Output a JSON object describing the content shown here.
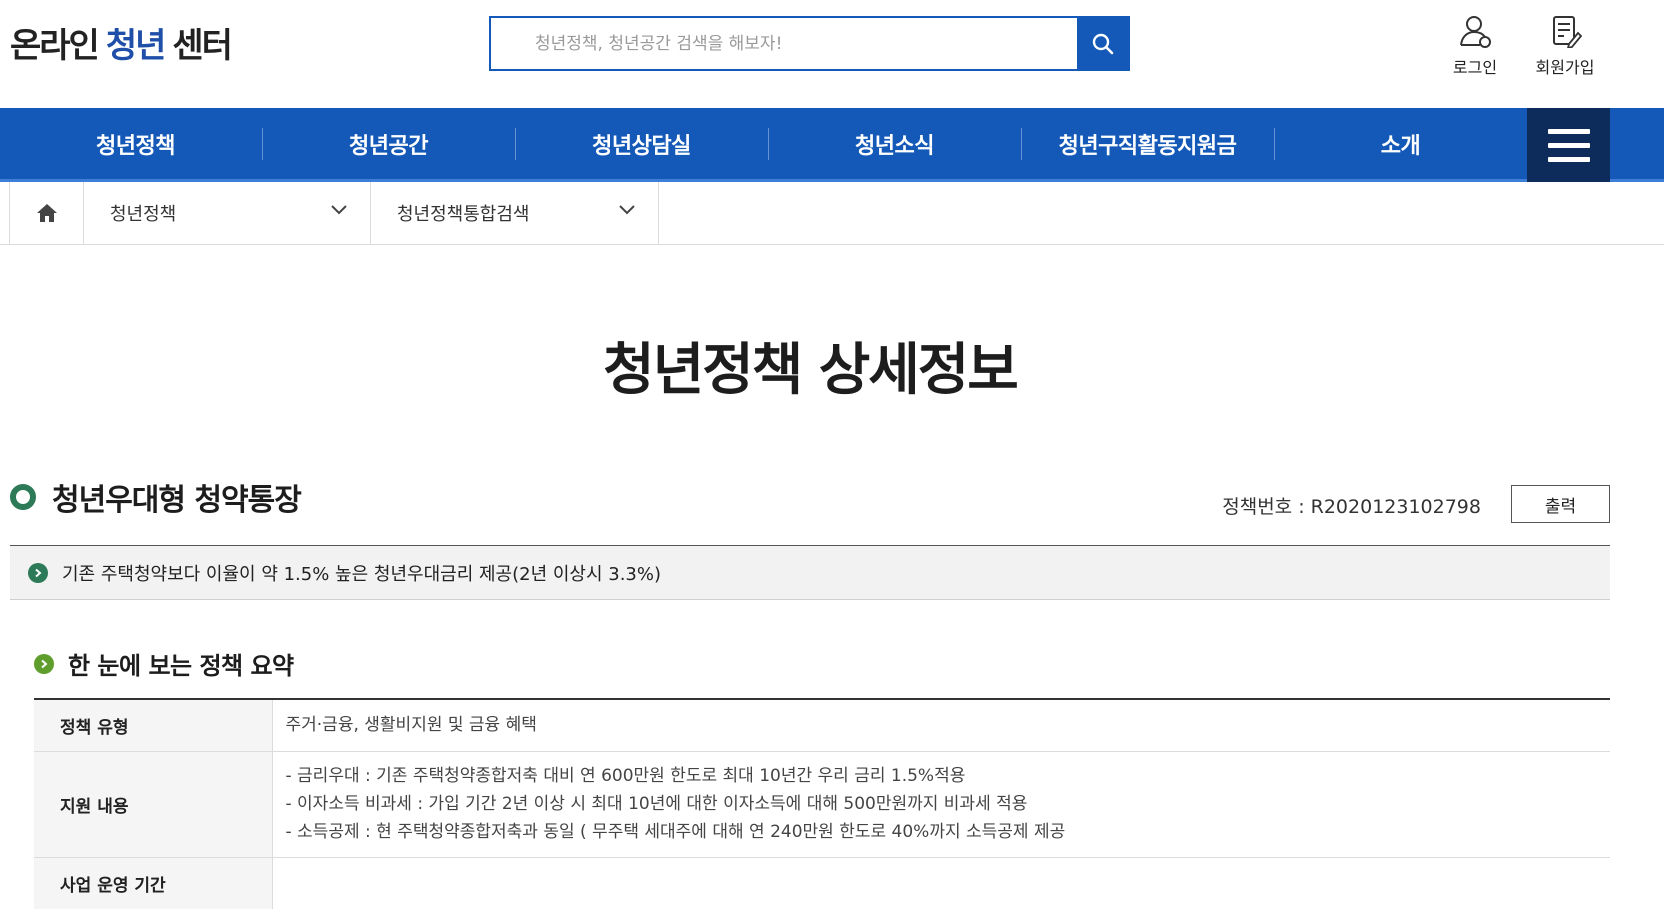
{
  "header": {
    "logo": {
      "part1": "온라인",
      "part2": "청년",
      "part3": "센터"
    },
    "search": {
      "placeholder": "청년정책, 청년공간 검색을 해보자!",
      "value": ""
    },
    "utils": {
      "login": "로그인",
      "join": "회원가입"
    }
  },
  "gnb": {
    "items": [
      "청년정책",
      "청년공간",
      "청년상담실",
      "청년소식",
      "청년구직활동지원금",
      "소개"
    ]
  },
  "location": {
    "depth1": "청년정책",
    "depth2": "청년정책통합검색"
  },
  "page": {
    "title": "청년정책 상세정보"
  },
  "policy": {
    "name": "청년우대형 청약통장",
    "number_label": "정책번호 : R2020123102798",
    "print_label": "출력",
    "intro": "기존 주택청약보다 이율이 약 1.5% 높은 청년우대금리 제공(2년 이상시 3.3%)"
  },
  "summary": {
    "heading": "한 눈에 보는 정책 요약",
    "rows": [
      {
        "label": "정책 유형",
        "lines": [
          "주거·금융, 생활비지원 및 금융 혜택"
        ]
      },
      {
        "label": "지원 내용",
        "lines": [
          "- 금리우대 : 기존 주택청약종합저축 대비 연 600만원 한도로 최대 10년간 우리 금리 1.5%적용",
          "- 이자소득 비과세 : 가입 기간 2년 이상 시 최대 10년에 대한 이자소득에 대해 500만원까지 비과세 적용",
          "- 소득공제 : 현 주택청약종합저축과 동일 ( 무주택 세대주에 대해 연 240만원 한도로 40%까지 소득공제 제공"
        ]
      },
      {
        "label": "사업 운영 기간",
        "lines": []
      }
    ]
  },
  "colors": {
    "primary": "#1459b8",
    "allmenu": "#0d2c5c",
    "green": "#2d7a58",
    "lightgreen": "#5f9e2c"
  }
}
